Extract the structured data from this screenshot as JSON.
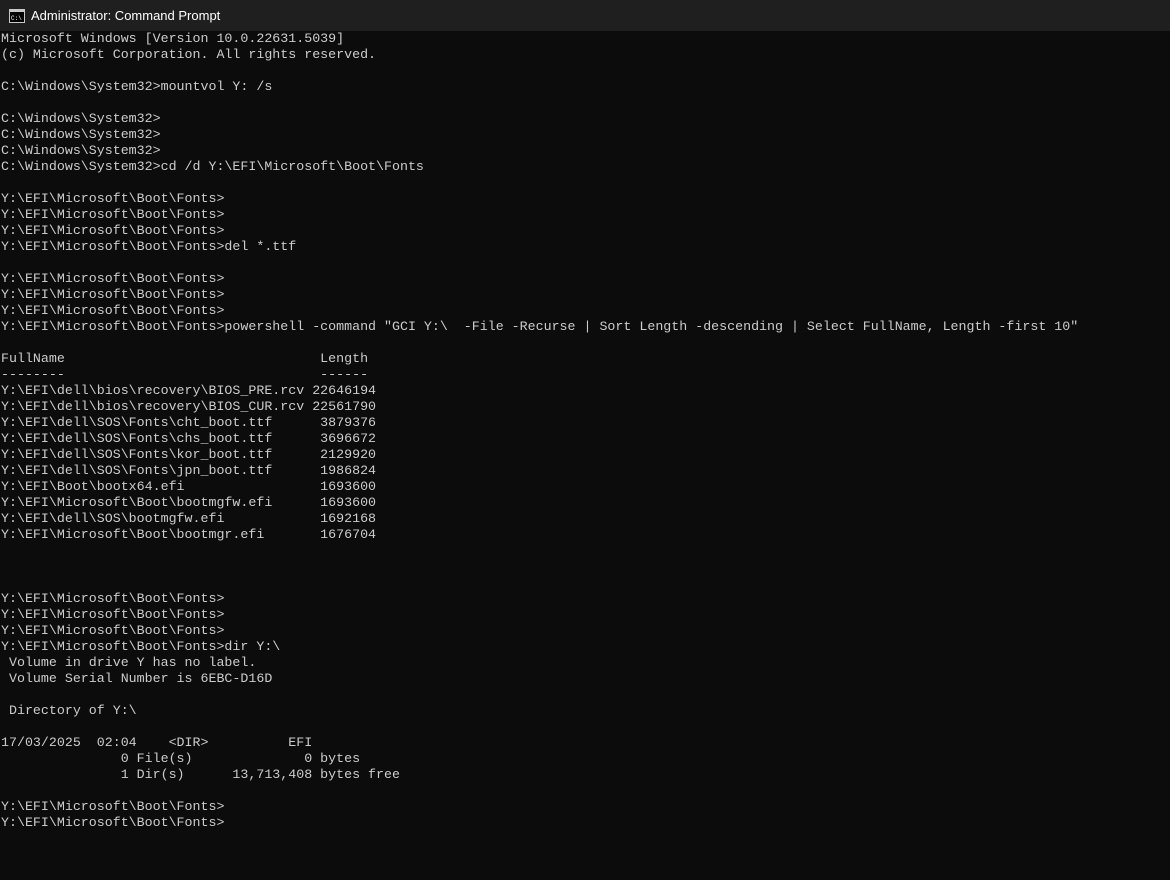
{
  "window": {
    "title": "Administrator: Command Prompt",
    "icon": "command-prompt-icon",
    "background_color": "#0c0c0c",
    "text_color": "#cccccc"
  },
  "console": {
    "lines": [
      "Microsoft Windows [Version 10.0.22631.5039]",
      "(c) Microsoft Corporation. All rights reserved.",
      "",
      "C:\\Windows\\System32>mountvol Y: /s",
      "",
      "C:\\Windows\\System32>",
      "C:\\Windows\\System32>",
      "C:\\Windows\\System32>",
      "C:\\Windows\\System32>cd /d Y:\\EFI\\Microsoft\\Boot\\Fonts",
      "",
      "Y:\\EFI\\Microsoft\\Boot\\Fonts>",
      "Y:\\EFI\\Microsoft\\Boot\\Fonts>",
      "Y:\\EFI\\Microsoft\\Boot\\Fonts>",
      "Y:\\EFI\\Microsoft\\Boot\\Fonts>del *.ttf",
      "",
      "Y:\\EFI\\Microsoft\\Boot\\Fonts>",
      "Y:\\EFI\\Microsoft\\Boot\\Fonts>",
      "Y:\\EFI\\Microsoft\\Boot\\Fonts>",
      "Y:\\EFI\\Microsoft\\Boot\\Fonts>powershell -command \"GCI Y:\\  -File -Recurse | Sort Length -descending | Select FullName, Length -first 10\"",
      "",
      "FullName                                Length",
      "--------                                ------",
      "Y:\\EFI\\dell\\bios\\recovery\\BIOS_PRE.rcv 22646194",
      "Y:\\EFI\\dell\\bios\\recovery\\BIOS_CUR.rcv 22561790",
      "Y:\\EFI\\dell\\SOS\\Fonts\\cht_boot.ttf      3879376",
      "Y:\\EFI\\dell\\SOS\\Fonts\\chs_boot.ttf      3696672",
      "Y:\\EFI\\dell\\SOS\\Fonts\\kor_boot.ttf      2129920",
      "Y:\\EFI\\dell\\SOS\\Fonts\\jpn_boot.ttf      1986824",
      "Y:\\EFI\\Boot\\bootx64.efi                 1693600",
      "Y:\\EFI\\Microsoft\\Boot\\bootmgfw.efi      1693600",
      "Y:\\EFI\\dell\\SOS\\bootmgfw.efi            1692168",
      "Y:\\EFI\\Microsoft\\Boot\\bootmgr.efi       1676704",
      "",
      "",
      "",
      "Y:\\EFI\\Microsoft\\Boot\\Fonts>",
      "Y:\\EFI\\Microsoft\\Boot\\Fonts>",
      "Y:\\EFI\\Microsoft\\Boot\\Fonts>",
      "Y:\\EFI\\Microsoft\\Boot\\Fonts>dir Y:\\",
      " Volume in drive Y has no label.",
      " Volume Serial Number is 6EBC-D16D",
      "",
      " Directory of Y:\\",
      "",
      "17/03/2025  02:04    <DIR>          EFI",
      "               0 File(s)              0 bytes",
      "               1 Dir(s)      13,713,408 bytes free",
      "",
      "Y:\\EFI\\Microsoft\\Boot\\Fonts>",
      "Y:\\EFI\\Microsoft\\Boot\\Fonts>"
    ]
  }
}
